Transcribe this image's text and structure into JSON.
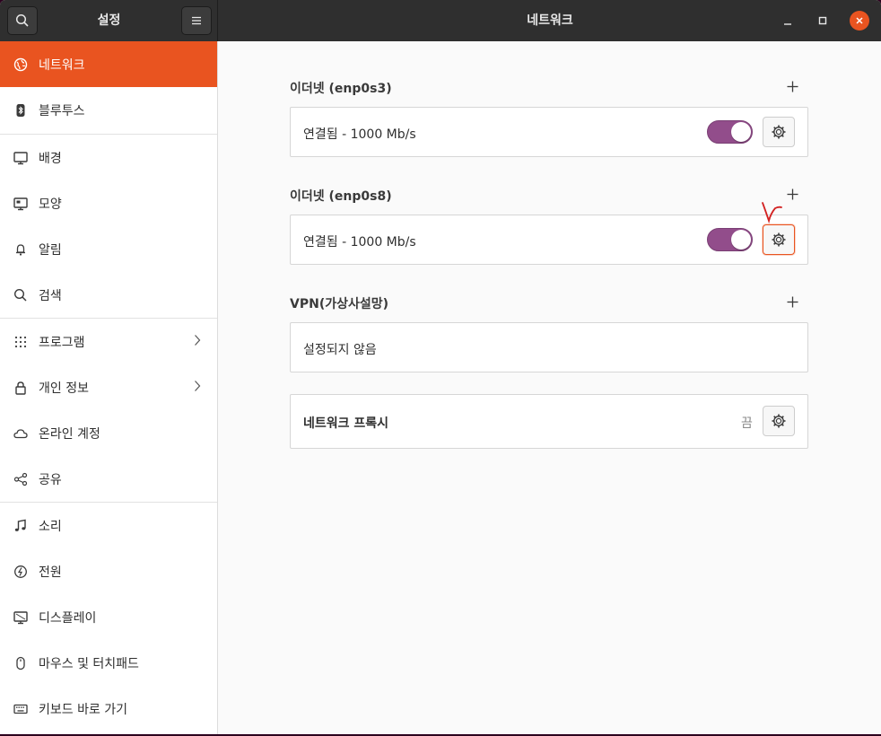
{
  "header": {
    "sidebar_title": "설정",
    "main_title": "네트워크"
  },
  "sidebar": {
    "items": [
      {
        "label": "네트워크",
        "icon": "network-icon"
      },
      {
        "label": "블루투스",
        "icon": "bluetooth-icon"
      },
      {
        "label": "배경",
        "icon": "background-icon"
      },
      {
        "label": "모양",
        "icon": "appearance-icon"
      },
      {
        "label": "알림",
        "icon": "bell-icon"
      },
      {
        "label": "검색",
        "icon": "search-icon"
      },
      {
        "label": "프로그램",
        "icon": "apps-grid-icon"
      },
      {
        "label": "개인 정보",
        "icon": "lock-icon"
      },
      {
        "label": "온라인 계정",
        "icon": "cloud-icon"
      },
      {
        "label": "공유",
        "icon": "share-icon"
      },
      {
        "label": "소리",
        "icon": "music-note-icon"
      },
      {
        "label": "전원",
        "icon": "power-icon"
      },
      {
        "label": "디스플레이",
        "icon": "display-icon"
      },
      {
        "label": "마우스 및 터치패드",
        "icon": "mouse-icon"
      },
      {
        "label": "키보드 바로 가기",
        "icon": "keyboard-icon"
      }
    ]
  },
  "ethernet1": {
    "title": "이더넷 (enp0s3)",
    "status": "연결됨 - 1000 Mb/s",
    "enabled": true
  },
  "ethernet2": {
    "title": "이더넷 (enp0s8)",
    "status": "연결됨 - 1000 Mb/s",
    "enabled": true
  },
  "vpn": {
    "title": "VPN(가상사설망)",
    "status": "설정되지 않음"
  },
  "proxy": {
    "title": "네트워크 프록시",
    "status": "끔"
  },
  "colors": {
    "accent": "#e95420",
    "toggle_on": "#924d8b",
    "annotation": "#d22020"
  }
}
